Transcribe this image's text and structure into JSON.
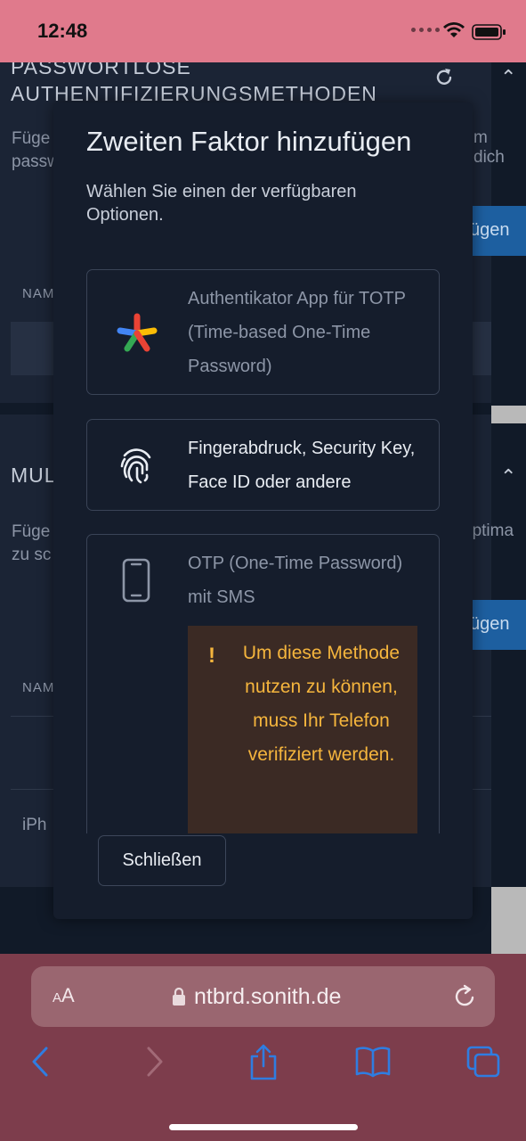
{
  "status_bar": {
    "time": "12:48"
  },
  "background_page": {
    "section1": {
      "title_line1": "PASSWORTLOSE",
      "title_line2": "AUTHENTIFIZIERUNGSMETHODEN",
      "desc_line1": "Füge",
      "desc_line2": "passw",
      "desc_right": "m dich",
      "button": "ügen",
      "column": "NAM"
    },
    "section2": {
      "title": "MUL",
      "desc_line1": "Füge",
      "desc_line2": "zu sc",
      "desc_right": "optima",
      "button": "ügen",
      "column": "NAM",
      "row_text": "iPh"
    }
  },
  "modal": {
    "title": "Zweiten Faktor hinzufügen",
    "subtitle": "Wählen Sie einen der verfügbaren Optionen.",
    "options": [
      {
        "label": "Authentikator App für TOTP (Time-based One-Time Password)",
        "icon": "authenticator-icon",
        "enabled": false
      },
      {
        "label": "Fingerabdruck, Security Key, Face ID oder andere",
        "icon": "fingerprint-icon",
        "enabled": true
      },
      {
        "label": "OTP (One-Time Password) mit SMS",
        "icon": "phone-icon",
        "enabled": false
      }
    ],
    "warning": {
      "mark": "!",
      "text": "Um diese Methode nutzen zu können, muss Ihr Telefon verifiziert werden."
    },
    "close_label": "Schließen"
  },
  "browser": {
    "aa_label_small": "A",
    "aa_label_big": "A",
    "url": "ntbrd.sonith.de"
  },
  "colors": {
    "status_bar": "#e07a8c",
    "browser_chrome": "#7d3d4c",
    "accent_blue": "#1d5fa0",
    "warning_text": "#f5b53d",
    "warning_bg": "#3b2a24"
  }
}
